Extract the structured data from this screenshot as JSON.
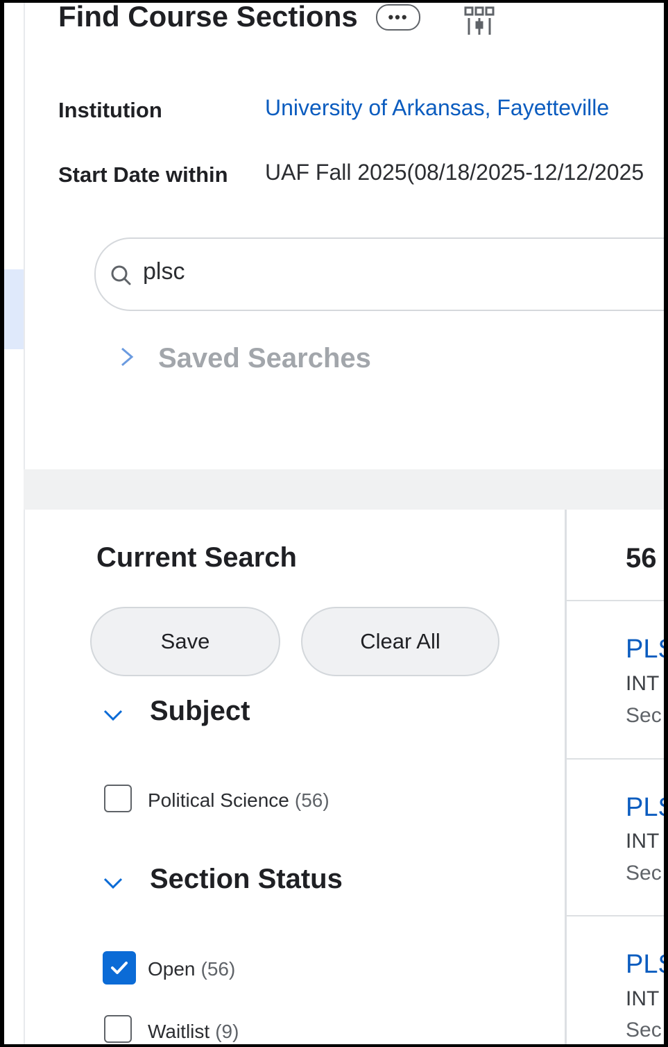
{
  "header": {
    "title": "Find Course Sections",
    "more_glyph": "•••"
  },
  "criteria": [
    {
      "label": "Institution",
      "value": "University of Arkansas, Fayetteville",
      "link": true
    },
    {
      "label": "Start Date within",
      "value": "UAF Fall 2025(08/18/2025-12/12/2025",
      "link": false
    }
  ],
  "search": {
    "query": "plsc"
  },
  "saved_searches": {
    "label": "Saved Searches"
  },
  "current_search": {
    "title": "Current Search",
    "save_label": "Save",
    "clear_label": "Clear All"
  },
  "facets": {
    "subject": {
      "title": "Subject",
      "options": [
        {
          "label": "Political Science",
          "count": "(56)",
          "checked": false
        }
      ]
    },
    "section_status": {
      "title": "Section Status",
      "options": [
        {
          "label": "Open",
          "count": "(56)",
          "checked": true
        },
        {
          "label": "Waitlist",
          "count": "(9)",
          "checked": false
        }
      ]
    }
  },
  "results": {
    "count": "56",
    "items": [
      {
        "code": "PLS",
        "line": "INT",
        "sec": "Sec"
      },
      {
        "code": "PLS",
        "line": "INT",
        "sec": "Sec"
      },
      {
        "code": "PLS",
        "line": "INT",
        "sec": "Sec"
      }
    ]
  },
  "colors": {
    "link": "#0b5cbf",
    "accent": "#0b6bd6",
    "band": "#f0f1f2"
  }
}
